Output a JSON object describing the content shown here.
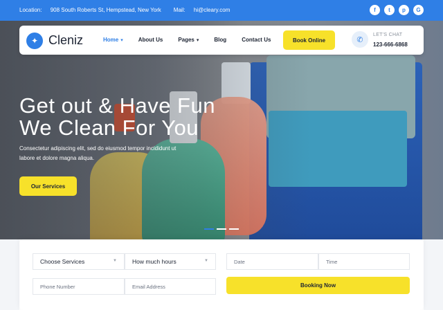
{
  "topbar": {
    "location_label": "Location:",
    "location_value": "908 South Roberts St, Hempstead, New York",
    "mail_label": "Mail:",
    "mail_value": "hi@cleary.com",
    "social": [
      "f",
      "t",
      "p",
      "G"
    ]
  },
  "nav": {
    "brand": "Cleniz",
    "menu": [
      {
        "label": "Home",
        "dropdown": true
      },
      {
        "label": "About Us",
        "dropdown": false
      },
      {
        "label": "Pages",
        "dropdown": true
      },
      {
        "label": "Blog",
        "dropdown": false
      },
      {
        "label": "Contact Us",
        "dropdown": false
      }
    ],
    "book_label": "Book Online",
    "chat_label": "LET'S CHAT",
    "chat_number": "123-666-6868"
  },
  "hero": {
    "headline_line1": "Get out & Have Fun",
    "headline_line2": "We Clean For You",
    "subtext": "Consectetur adipiscing elit, sed do eiusmod tempor incididunt ut labore et dolore magna aliqua.",
    "cta_label": "Our Services"
  },
  "booking": {
    "service_select": "Choose Services",
    "hours_select": "How much hours",
    "date_placeholder": "Date",
    "time_placeholder": "Time",
    "phone_placeholder": "Phone Number",
    "email_placeholder": "Email Address",
    "submit_label": "Booking Now"
  },
  "colors": {
    "accent_blue": "#2f7fe6",
    "accent_yellow": "#f7e12a",
    "text_dark": "#1d2433"
  }
}
